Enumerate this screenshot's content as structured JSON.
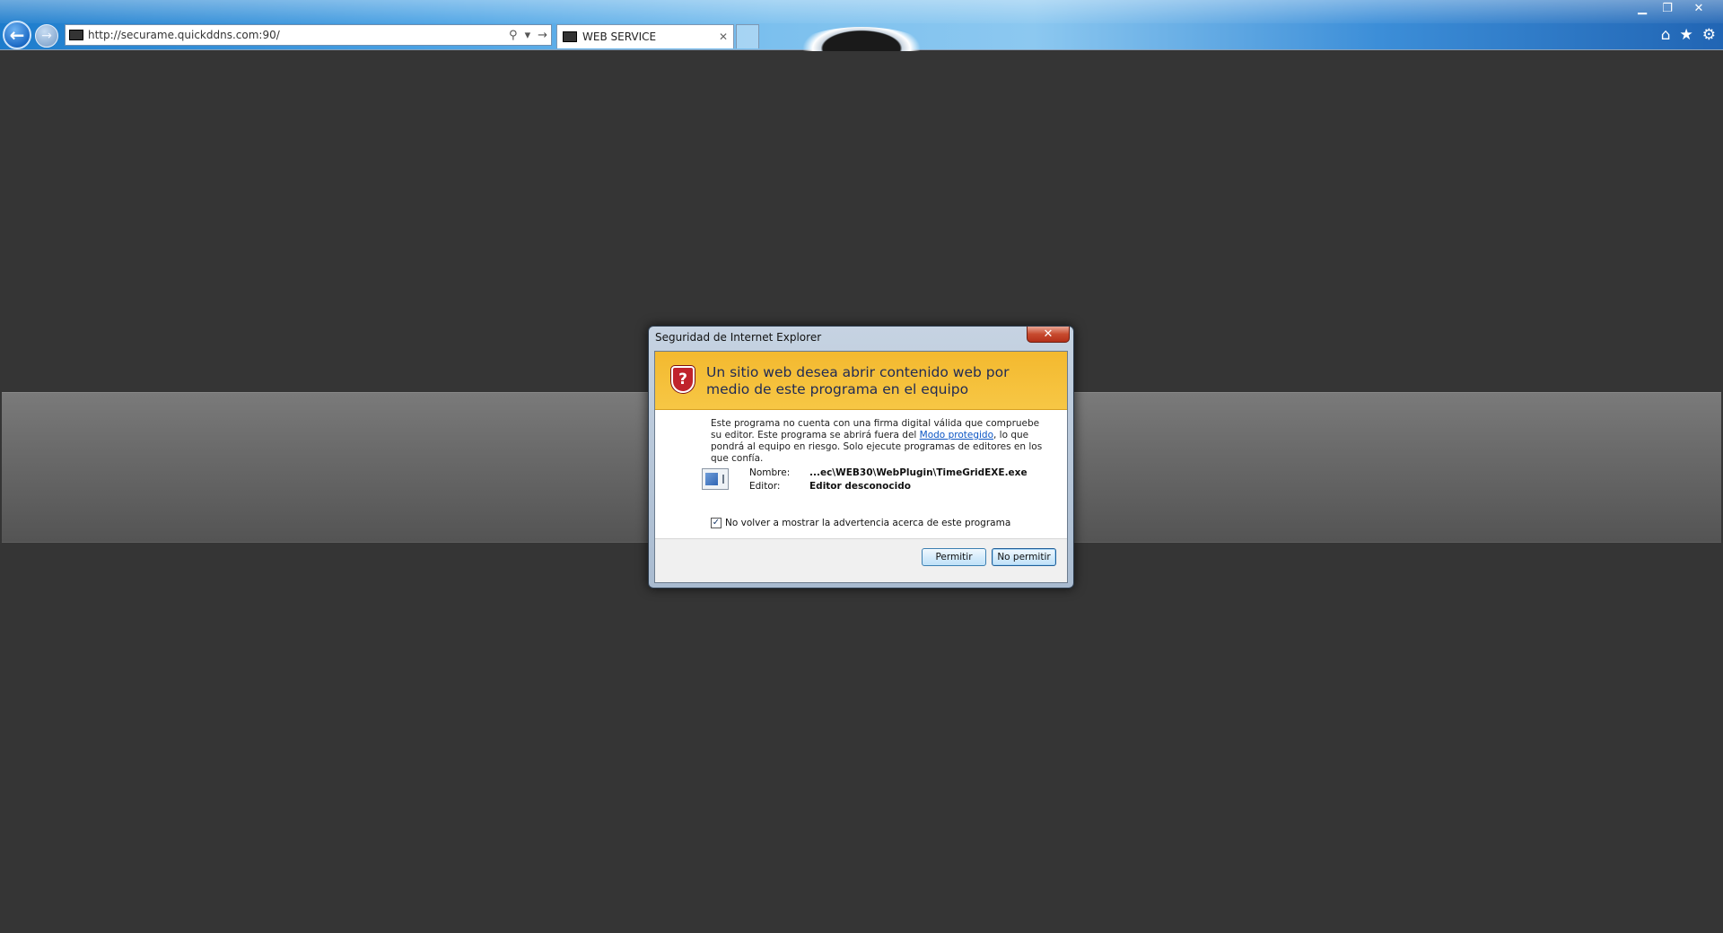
{
  "browser": {
    "address": "http://securame.quickddns.com:90/",
    "tab_title": "WEB SERVICE",
    "tab_close": "✕",
    "back_glyph": "←",
    "forward_glyph": "→",
    "search_glyph": "⚲",
    "dropdown_glyph": "▾",
    "go_glyph": "→",
    "window_controls": {
      "minimize": "▁",
      "maximize": "❐",
      "close": "✕"
    },
    "toolbar": {
      "home": "⌂",
      "favorites": "★",
      "tools": "⚙"
    },
    "icons": [
      "back-icon",
      "forward-icon",
      "search-icon",
      "home-icon",
      "star-icon",
      "gear-icon"
    ]
  },
  "dialog": {
    "title": "Seguridad de Internet Explorer",
    "close_glyph": "✕",
    "shield_glyph": "?",
    "heading": "Un sitio web desea abrir contenido web por medio de este programa en el equipo",
    "description_part1": "Este programa no cuenta con una firma digital válida que compruebe su editor. Este programa se abrirá fuera del ",
    "description_link": "Modo protegido",
    "description_part2": ", lo que pondrá al equipo en riesgo. Solo ejecute programas de editores en los que confía.",
    "name_label": "Nombre:",
    "name_value": "...ec\\WEB30\\WebPlugin\\TimeGridEXE.exe",
    "publisher_label": "Editor:",
    "publisher_value": "Editor desconocido",
    "checkbox_label": "No volver a mostrar la advertencia acerca de este programa",
    "checkbox_checked": true,
    "check_glyph": "✓",
    "allow_label": "Permitir",
    "deny_label": "No permitir"
  },
  "colors": {
    "page_background": "#353535",
    "header_band": "#f5bf3a",
    "link": "#0b55c4",
    "shield": "#c0232c"
  }
}
